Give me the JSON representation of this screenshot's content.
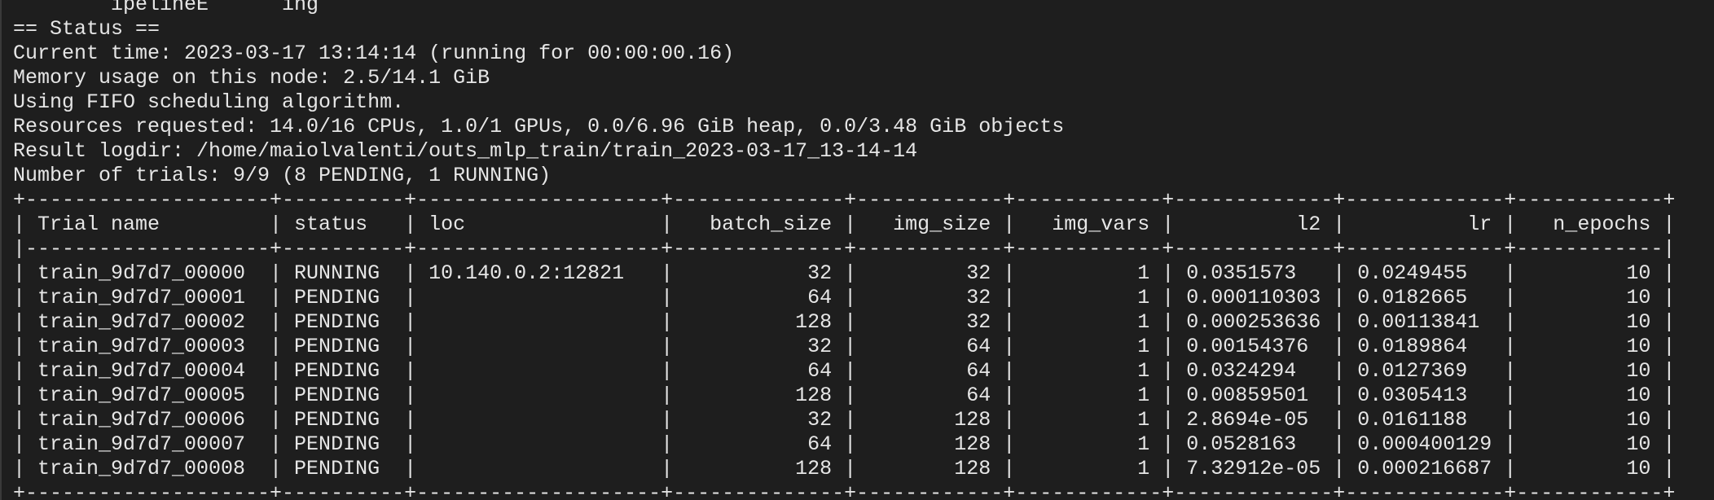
{
  "terminal": {
    "lines": [
      "        ipelineE      ing",
      "== Status ==",
      "Current time: 2023-03-17 13:14:14 (running for 00:00:00.16)",
      "Memory usage on this node: 2.5/14.1 GiB",
      "Using FIFO scheduling algorithm.",
      "Resources requested: 14.0/16 CPUs, 1.0/1 GPUs, 0.0/6.96 GiB heap, 0.0/3.48 GiB objects",
      "Result logdir: /home/maiolvalenti/outs_mlp_train/train_2023-03-17_13-14-14",
      "Number of trials: 9/9 (8 PENDING, 1 RUNNING)",
      "+--------------------+----------+--------------------+--------------+------------+------------+-------------+-------------+------------+",
      "| Trial name         | status   | loc                |   batch_size |   img_size |   img_vars |          l2 |          lr |   n_epochs |",
      "|--------------------+----------+--------------------+--------------+------------+------------+-------------+-------------+------------|",
      "| train_9d7d7_00000  | RUNNING  | 10.140.0.2:12821   |           32 |         32 |          1 | 0.0351573   | 0.0249455   |         10 |",
      "| train_9d7d7_00001  | PENDING  |                    |           64 |         32 |          1 | 0.000110303 | 0.0182665   |         10 |",
      "| train_9d7d7_00002  | PENDING  |                    |          128 |         32 |          1 | 0.000253636 | 0.00113841  |         10 |",
      "| train_9d7d7_00003  | PENDING  |                    |           32 |         64 |          1 | 0.00154376  | 0.0189864   |         10 |",
      "| train_9d7d7_00004  | PENDING  |                    |           64 |         64 |          1 | 0.0324294   | 0.0127369   |         10 |",
      "| train_9d7d7_00005  | PENDING  |                    |          128 |         64 |          1 | 0.00859501  | 0.0305413   |         10 |",
      "| train_9d7d7_00006  | PENDING  |                    |           32 |        128 |          1 | 2.8694e-05  | 0.0161188   |         10 |",
      "| train_9d7d7_00007  | PENDING  |                    |           64 |        128 |          1 | 0.0528163   | 0.000400129 |         10 |",
      "| train_9d7d7_00008  | PENDING  |                    |          128 |        128 |          1 | 7.32912e-05 | 0.000216687 |         10 |",
      "+--------------------+----------+--------------------+--------------+------------+------------+-------------+-------------+------------+"
    ]
  }
}
